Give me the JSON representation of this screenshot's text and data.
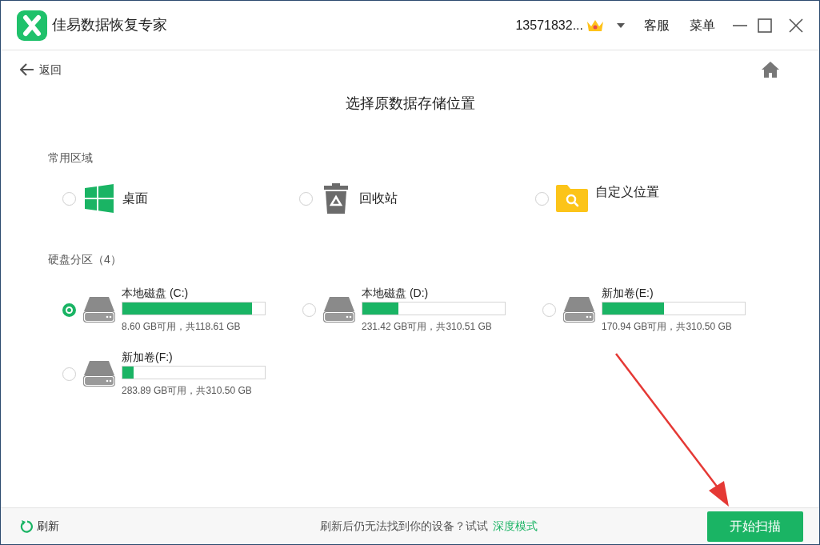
{
  "app": {
    "title": "佳易数据恢复专家"
  },
  "account": {
    "user": "13571832...",
    "vip": true
  },
  "header_menu": [
    "客服",
    "菜单"
  ],
  "nav": {
    "back": "返回"
  },
  "page_title": "选择原数据存储位置",
  "common": {
    "heading": "常用区域",
    "items": [
      {
        "kind": "desktop",
        "label": "桌面",
        "selected": false
      },
      {
        "kind": "recycle",
        "label": "回收站",
        "selected": false
      },
      {
        "kind": "custom",
        "label": "自定义位置",
        "selected": false
      }
    ]
  },
  "disks": {
    "heading": "硬盘分区（4）",
    "items": [
      {
        "name": "本地磁盘 (C:)",
        "level": 0.91,
        "info": "8.60 GB可用，共118.61 GB",
        "selected": true
      },
      {
        "name": "本地磁盘 (D:)",
        "level": 0.25,
        "info": "231.42 GB可用，共310.51 GB",
        "selected": false
      },
      {
        "name": "新加卷(E:)",
        "level": 0.43,
        "info": "170.94 GB可用，共310.50 GB",
        "selected": false
      },
      {
        "name": "新加卷(F:)",
        "level": 0.08,
        "info": "283.89 GB可用，共310.50 GB",
        "selected": false
      }
    ]
  },
  "footer": {
    "refresh": "刷新",
    "hint": "刷新后仍无法找到你的设备？试试",
    "deep_mode": "深度模式",
    "scan": "开始扫描"
  }
}
